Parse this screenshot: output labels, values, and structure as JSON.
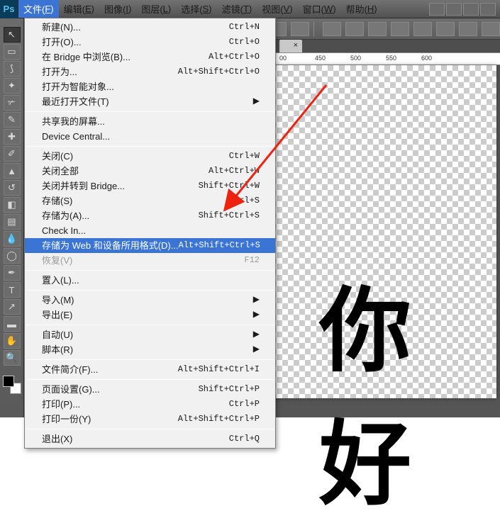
{
  "app": {
    "logo": "Ps"
  },
  "menubar": [
    {
      "label": "文件",
      "accel": "F",
      "open": true
    },
    {
      "label": "编辑",
      "accel": "E"
    },
    {
      "label": "图像",
      "accel": "I"
    },
    {
      "label": "图层",
      "accel": "L"
    },
    {
      "label": "选择",
      "accel": "S"
    },
    {
      "label": "滤镜",
      "accel": "T"
    },
    {
      "label": "视图",
      "accel": "V"
    },
    {
      "label": "窗口",
      "accel": "W"
    },
    {
      "label": "帮助",
      "accel": "H"
    }
  ],
  "file_menu": [
    {
      "label": "新建(N)...",
      "shortcut": "Ctrl+N"
    },
    {
      "label": "打开(O)...",
      "shortcut": "Ctrl+O"
    },
    {
      "label": "在 Bridge 中浏览(B)...",
      "shortcut": "Alt+Ctrl+O"
    },
    {
      "label": "打开为...",
      "shortcut": "Alt+Shift+Ctrl+O"
    },
    {
      "label": "打开为智能对象...",
      "shortcut": ""
    },
    {
      "label": "最近打开文件(T)",
      "shortcut": "",
      "submenu": true
    },
    {
      "sep": true
    },
    {
      "label": "共享我的屏幕...",
      "shortcut": ""
    },
    {
      "label": "Device Central...",
      "shortcut": ""
    },
    {
      "sep": true
    },
    {
      "label": "关闭(C)",
      "shortcut": "Ctrl+W"
    },
    {
      "label": "关闭全部",
      "shortcut": "Alt+Ctrl+W"
    },
    {
      "label": "关闭并转到 Bridge...",
      "shortcut": "Shift+Ctrl+W"
    },
    {
      "label": "存储(S)",
      "shortcut": "Ctrl+S"
    },
    {
      "label": "存储为(A)...",
      "shortcut": "Shift+Ctrl+S"
    },
    {
      "label": "Check In...",
      "shortcut": ""
    },
    {
      "label": "存储为 Web 和设备所用格式(D)...",
      "shortcut": "Alt+Shift+Ctrl+S",
      "highlight": true
    },
    {
      "label": "恢复(V)",
      "shortcut": "F12",
      "disabled": true
    },
    {
      "sep": true
    },
    {
      "label": "置入(L)...",
      "shortcut": ""
    },
    {
      "sep": true
    },
    {
      "label": "导入(M)",
      "shortcut": "",
      "submenu": true
    },
    {
      "label": "导出(E)",
      "shortcut": "",
      "submenu": true
    },
    {
      "sep": true
    },
    {
      "label": "自动(U)",
      "shortcut": "",
      "submenu": true
    },
    {
      "label": "脚本(R)",
      "shortcut": "",
      "submenu": true
    },
    {
      "sep": true
    },
    {
      "label": "文件简介(F)...",
      "shortcut": "Alt+Shift+Ctrl+I"
    },
    {
      "sep": true
    },
    {
      "label": "页面设置(G)...",
      "shortcut": "Shift+Ctrl+P"
    },
    {
      "label": "打印(P)...",
      "shortcut": "Ctrl+P"
    },
    {
      "label": "打印一份(Y)",
      "shortcut": "Alt+Shift+Ctrl+P"
    },
    {
      "sep": true
    },
    {
      "label": "退出(X)",
      "shortcut": "Ctrl+Q"
    }
  ],
  "ruler_h": [
    "00",
    "450",
    "500",
    "550",
    "600"
  ],
  "canvas_text": "你好",
  "options_icons": [
    "rect-icon",
    "feather-icon",
    "style-icon",
    "width-icon",
    "height-icon"
  ],
  "options_right": [
    "align-left-icon",
    "align-center-icon",
    "align-right-icon",
    "align-top-icon",
    "align-middle-icon",
    "align-bottom-icon",
    "distribute-icon",
    "more-icon"
  ],
  "topbar_icons": [
    "bridge-icon",
    "history-icon",
    "ruler-icon",
    "screen-icon"
  ],
  "tools": [
    {
      "name": "move-tool",
      "glyph": "↖",
      "sel": true
    },
    {
      "name": "marquee-tool",
      "glyph": "▭"
    },
    {
      "name": "lasso-tool",
      "glyph": "⟆"
    },
    {
      "name": "wand-tool",
      "glyph": "✦"
    },
    {
      "name": "crop-tool",
      "glyph": "✃"
    },
    {
      "name": "eyedropper-tool",
      "glyph": "✎"
    },
    {
      "name": "healing-tool",
      "glyph": "✚"
    },
    {
      "name": "brush-tool",
      "glyph": "✐"
    },
    {
      "name": "stamp-tool",
      "glyph": "▲"
    },
    {
      "name": "history-brush-tool",
      "glyph": "↺"
    },
    {
      "name": "eraser-tool",
      "glyph": "◧"
    },
    {
      "name": "gradient-tool",
      "glyph": "▤"
    },
    {
      "name": "blur-tool",
      "glyph": "💧"
    },
    {
      "name": "dodge-tool",
      "glyph": "◯"
    },
    {
      "name": "pen-tool",
      "glyph": "✒"
    },
    {
      "name": "type-tool",
      "glyph": "T"
    },
    {
      "name": "path-tool",
      "glyph": "↗"
    },
    {
      "name": "shape-tool",
      "glyph": "▬"
    },
    {
      "name": "hand-tool",
      "glyph": "✋"
    },
    {
      "name": "zoom-tool",
      "glyph": "🔍"
    }
  ]
}
